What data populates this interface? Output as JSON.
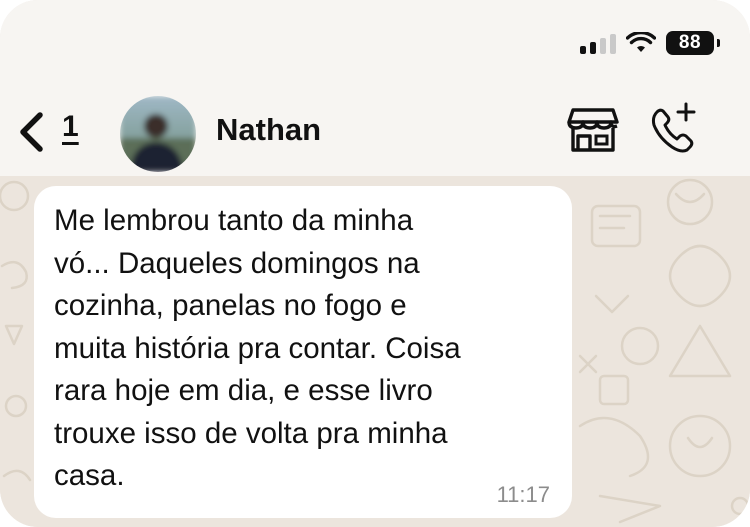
{
  "status_bar": {
    "battery_level": "88",
    "signal_bars_active": 2,
    "signal_bars_total": 4
  },
  "header": {
    "unread_count": "1",
    "contact_name": "Nathan",
    "icons": [
      "chevron-left-icon",
      "store-icon",
      "phone-add-icon"
    ]
  },
  "message": {
    "text": "Me lembrou tanto da minha vó... Daqueles domingos na cozinha, panelas no fogo e muita história pra contar. Coisa rara hoje em dia, e esse livro trouxe isso de volta pra minha casa.",
    "lines": [
      "Me lembrou tanto da minha",
      "vó... Daqueles domingos na",
      "cozinha, panelas no fogo e",
      "muita história pra contar. Coisa",
      "rara hoje em dia, e esse livro",
      "trouxe isso de volta pra minha",
      "casa."
    ],
    "time": "11:17"
  },
  "colors": {
    "header_bg": "#f7f5f2",
    "chat_bg": "#ece5dd",
    "bubble_bg": "#ffffff",
    "time_text": "#8c8c8c"
  }
}
